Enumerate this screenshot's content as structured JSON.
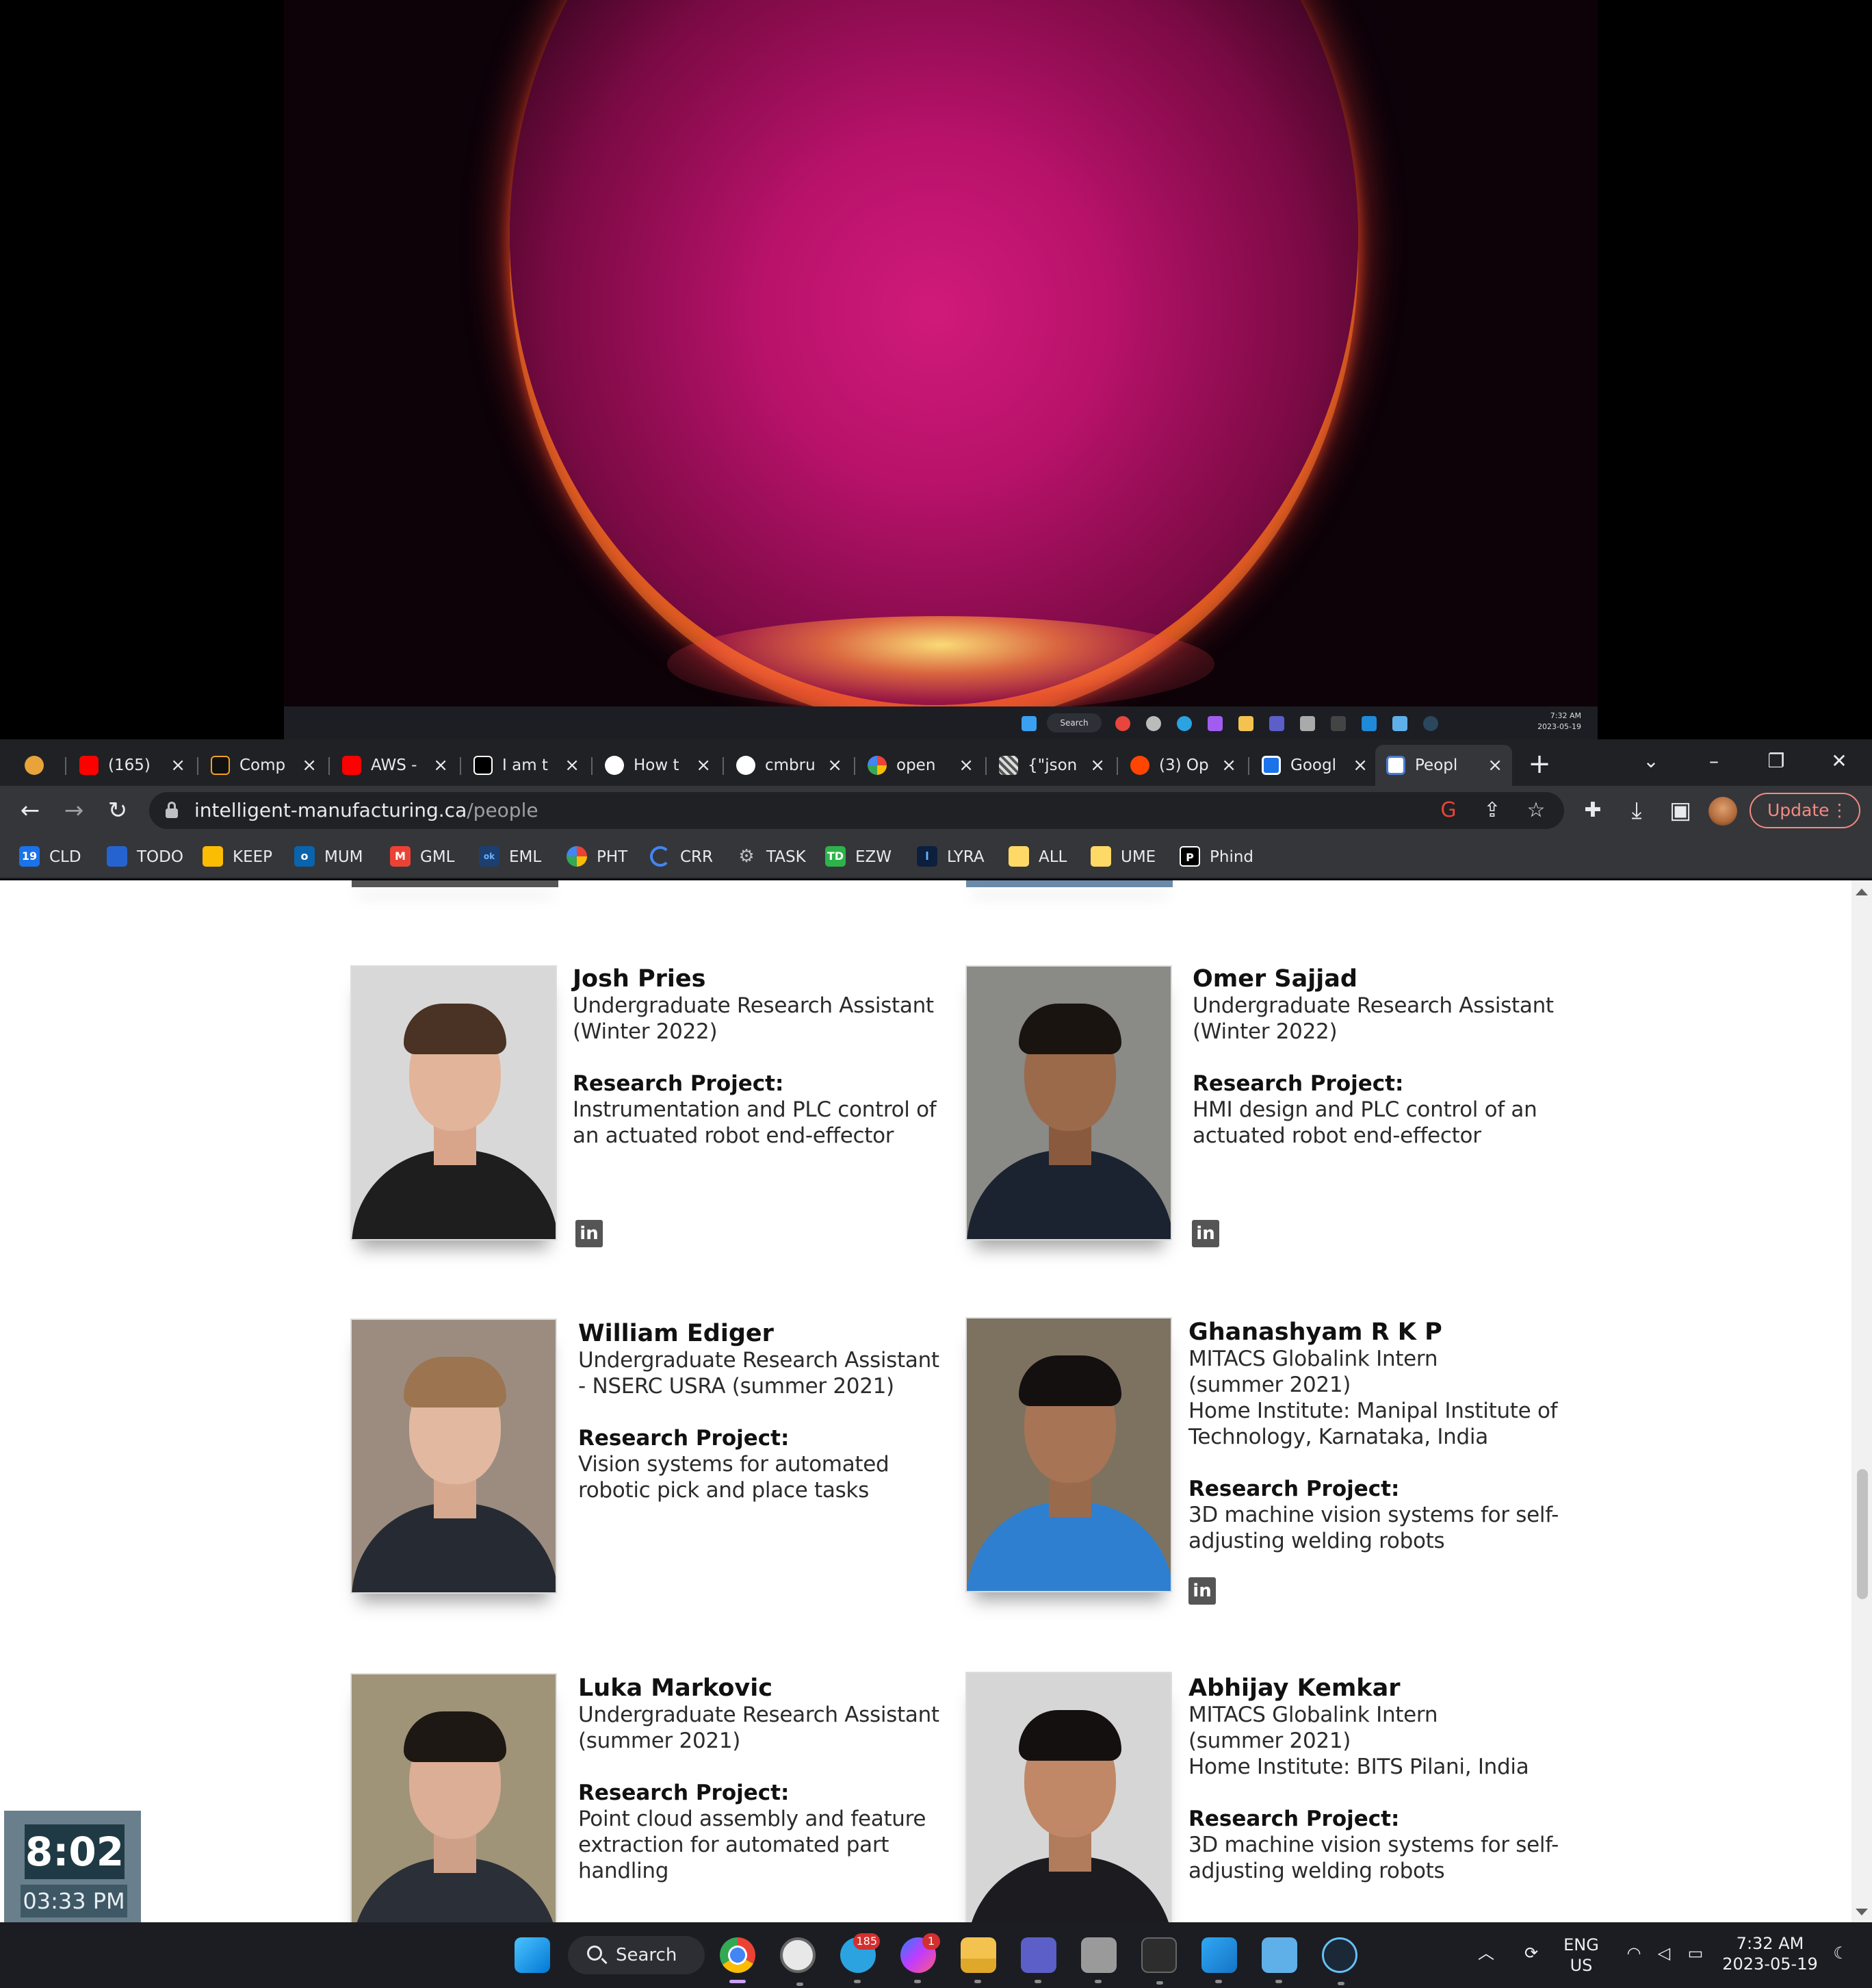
{
  "desktop": {
    "mini_taskbar": {
      "search_label": "Search",
      "time": "7:32 AM",
      "date": "2023-05-19"
    }
  },
  "browser": {
    "tabs": [
      {
        "label": "",
        "icon": "tmetric-icon",
        "color": "#e8a33a"
      },
      {
        "label": "(165)",
        "icon": "youtube-icon",
        "color": "#ff0000"
      },
      {
        "label": "Comp",
        "icon": "arrow-up-right-icon",
        "color": "#111111"
      },
      {
        "label": "AWS -",
        "icon": "youtube-icon",
        "color": "#ff0000"
      },
      {
        "label": "I am t",
        "icon": "p-logo-icon",
        "color": "#000000"
      },
      {
        "label": "How t",
        "icon": "github-icon",
        "color": "#ffffff"
      },
      {
        "label": "cmbru",
        "icon": "github-icon",
        "color": "#ffffff"
      },
      {
        "label": "open",
        "icon": "google-icon",
        "color": "#4285f4"
      },
      {
        "label": "{\"json",
        "icon": "qr-icon",
        "color": "#dddddd"
      },
      {
        "label": "(3) Op",
        "icon": "reddit-icon",
        "color": "#ff4500"
      },
      {
        "label": "Googl",
        "icon": "calendar-icon",
        "color": "#1a73e8"
      },
      {
        "label": "Peopl",
        "icon": "site-icon",
        "color": "#ffffff"
      }
    ],
    "new_tab_label": "+",
    "url_host": "intelligent-manufacturing.ca",
    "url_path": "/people",
    "update_label": "Update",
    "bookmarks": [
      {
        "label": "CLD",
        "icon": "calendar-icon",
        "color": "#1a73e8"
      },
      {
        "label": "TODO",
        "icon": "todo-icon",
        "color": "#2564cf"
      },
      {
        "label": "KEEP",
        "icon": "keep-icon",
        "color": "#fbbc04"
      },
      {
        "label": "MUM",
        "icon": "outlook-icon",
        "color": "#0a64ad"
      },
      {
        "label": "GML",
        "icon": "gmail-icon",
        "color": "#ea4335"
      },
      {
        "label": "EML",
        "icon": "mail-icon",
        "color": "#1c6fd1"
      },
      {
        "label": "PHT",
        "icon": "photos-icon",
        "color": "#34a853"
      },
      {
        "label": "CRR",
        "icon": "loading-icon",
        "color": "#4285f4"
      },
      {
        "label": "TASK",
        "icon": "gear-icon",
        "color": "#9aa0a6"
      },
      {
        "label": "EZW",
        "icon": "td-icon",
        "color": "#2db34a"
      },
      {
        "label": "LYRA",
        "icon": "l-icon",
        "color": "#2a6ad8"
      },
      {
        "label": "ALL",
        "icon": "note-icon",
        "color": "#ffd966"
      },
      {
        "label": "UME",
        "icon": "note-icon",
        "color": "#ffd966"
      },
      {
        "label": "Phind",
        "icon": "p-logo-icon",
        "color": "#000000"
      }
    ]
  },
  "people": [
    {
      "name": "Josh Pries",
      "lines": [
        "Undergraduate Research Assistant",
        "(Winter 2022)"
      ],
      "research_label": "Research Project:",
      "project": [
        "Instrumentation and PLC control of",
        "an actuated robot end-effector"
      ],
      "linkedin": "in"
    },
    {
      "name": "Omer Sajjad",
      "lines": [
        "Undergraduate Research Assistant",
        "(Winter 2022)"
      ],
      "research_label": "Research Project:",
      "project": [
        "HMI design and PLC control of an",
        "actuated robot end-effector"
      ],
      "linkedin": "in"
    },
    {
      "name": "William Ediger",
      "lines": [
        "Undergraduate Research Assistant",
        "- NSERC USRA (summer 2021)"
      ],
      "research_label": "Research Project:",
      "project": [
        "Vision systems for automated",
        "robotic pick and place tasks"
      ]
    },
    {
      "name": "Ghanashyam R K P",
      "lines": [
        "MITACS Globalink Intern",
        "(summer 2021)",
        "Home Institute: Manipal Institute of",
        "Technology, Karnataka, India"
      ],
      "research_label": "Research Project:",
      "project": [
        "3D machine vision systems for self-",
        "adjusting welding robots"
      ],
      "linkedin": "in"
    },
    {
      "name": "Luka Markovic",
      "lines": [
        "Undergraduate Research Assistant",
        "(summer 2021)"
      ],
      "research_label": "Research Project:",
      "project": [
        "Point cloud assembly and feature",
        "extraction for automated part",
        "handling"
      ]
    },
    {
      "name": "Abhijay Kemkar",
      "lines": [
        "MITACS Globalink Intern",
        "(summer 2021)",
        "Home Institute: BITS Pilani, India"
      ],
      "research_label": "Research Project:",
      "project": [
        "3D machine vision systems for self-",
        "adjusting welding robots"
      ]
    }
  ],
  "clock_widget": {
    "time": "8:02",
    "alt_time": "03:33 PM"
  },
  "taskbar": {
    "search_label": "Search",
    "telegram_badge": "185",
    "messenger_badge": "1",
    "language": "ENG",
    "region": "US",
    "time": "7:32 AM",
    "date": "2023-05-19"
  }
}
